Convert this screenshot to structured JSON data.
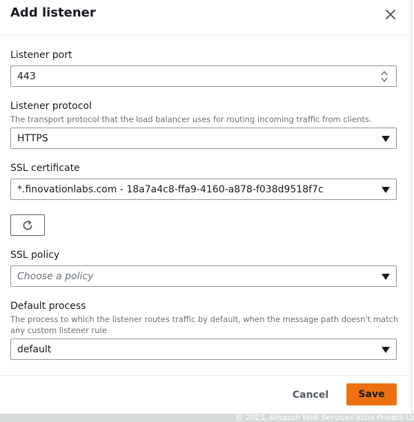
{
  "modal": {
    "title": "Add listener",
    "close_icon": "close-icon"
  },
  "listener_port": {
    "label": "Listener port",
    "value": "443"
  },
  "listener_protocol": {
    "label": "Listener protocol",
    "description": "The transport protocol that the load balancer uses for routing incoming traffic from clients.",
    "value": "HTTPS"
  },
  "ssl_certificate": {
    "label": "SSL certificate",
    "value": "*.finovationlabs.com - 18a7a4c8-ffa9-4160-a878-f038d9518f7c",
    "refresh_icon": "refresh-icon"
  },
  "ssl_policy": {
    "label": "SSL policy",
    "placeholder": "Choose a policy"
  },
  "default_process": {
    "label": "Default process",
    "description": "The process to which the listener routes traffic by default, when the message path doesn't match any custom listener rule",
    "value": "default"
  },
  "footer": {
    "cancel_label": "Cancel",
    "save_label": "Save",
    "copyright": "© 2023, Amazon Web Services India Private Lim"
  },
  "colors": {
    "primary_button": "#ec7211",
    "text": "#16191f",
    "muted": "#687078",
    "border": "#879596"
  }
}
